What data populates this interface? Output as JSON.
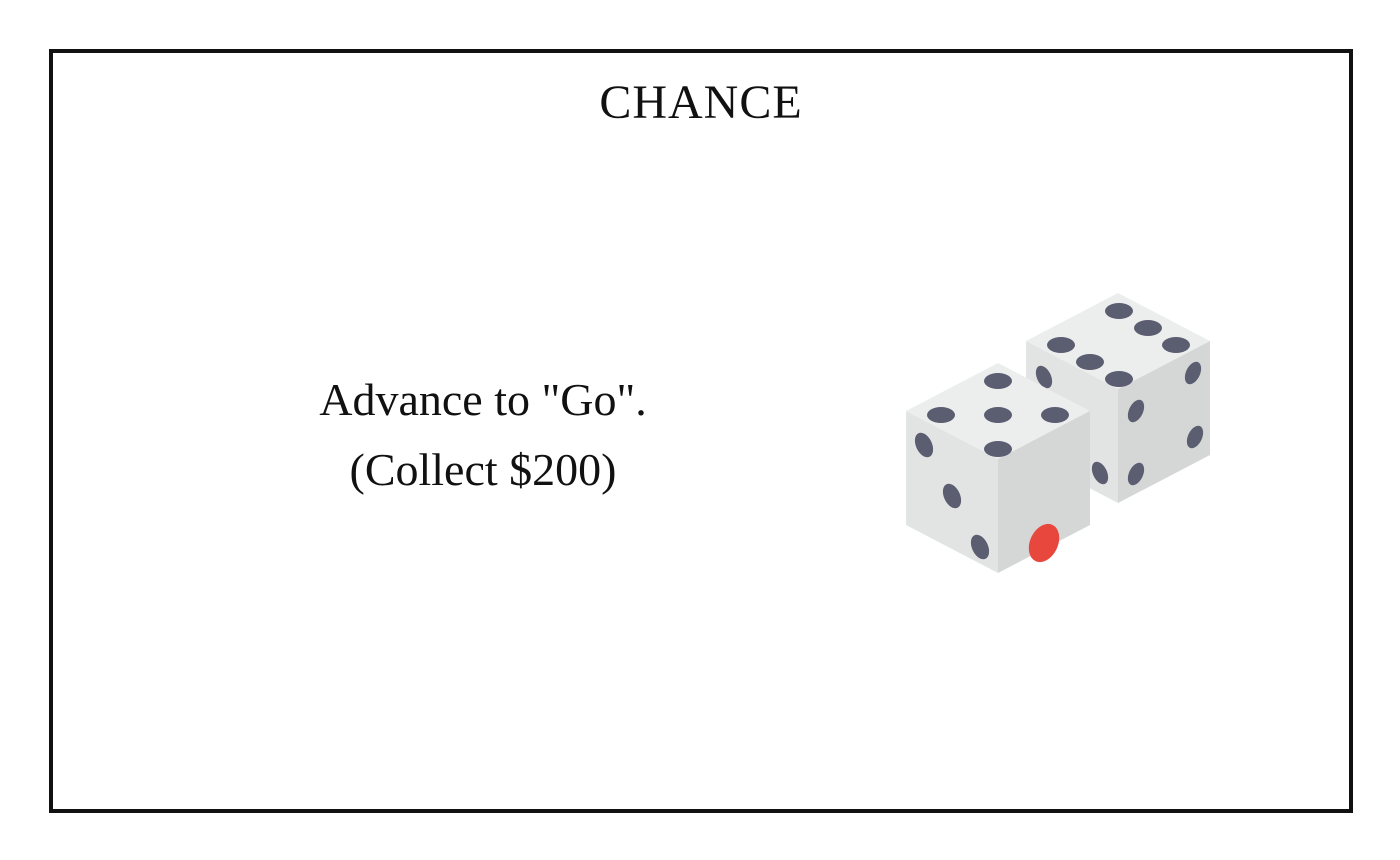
{
  "card": {
    "title": "CHANCE",
    "line1": "Advance to \"Go\".",
    "line2": "(Collect $200)",
    "illustration": "dice-icon"
  },
  "colors": {
    "border": "#111111",
    "die_top": "#eceeee",
    "die_left": "#e2e4e4",
    "die_right": "#d5d7d7",
    "pip": "#5b5d70",
    "pip_accent": "#e8473d"
  }
}
